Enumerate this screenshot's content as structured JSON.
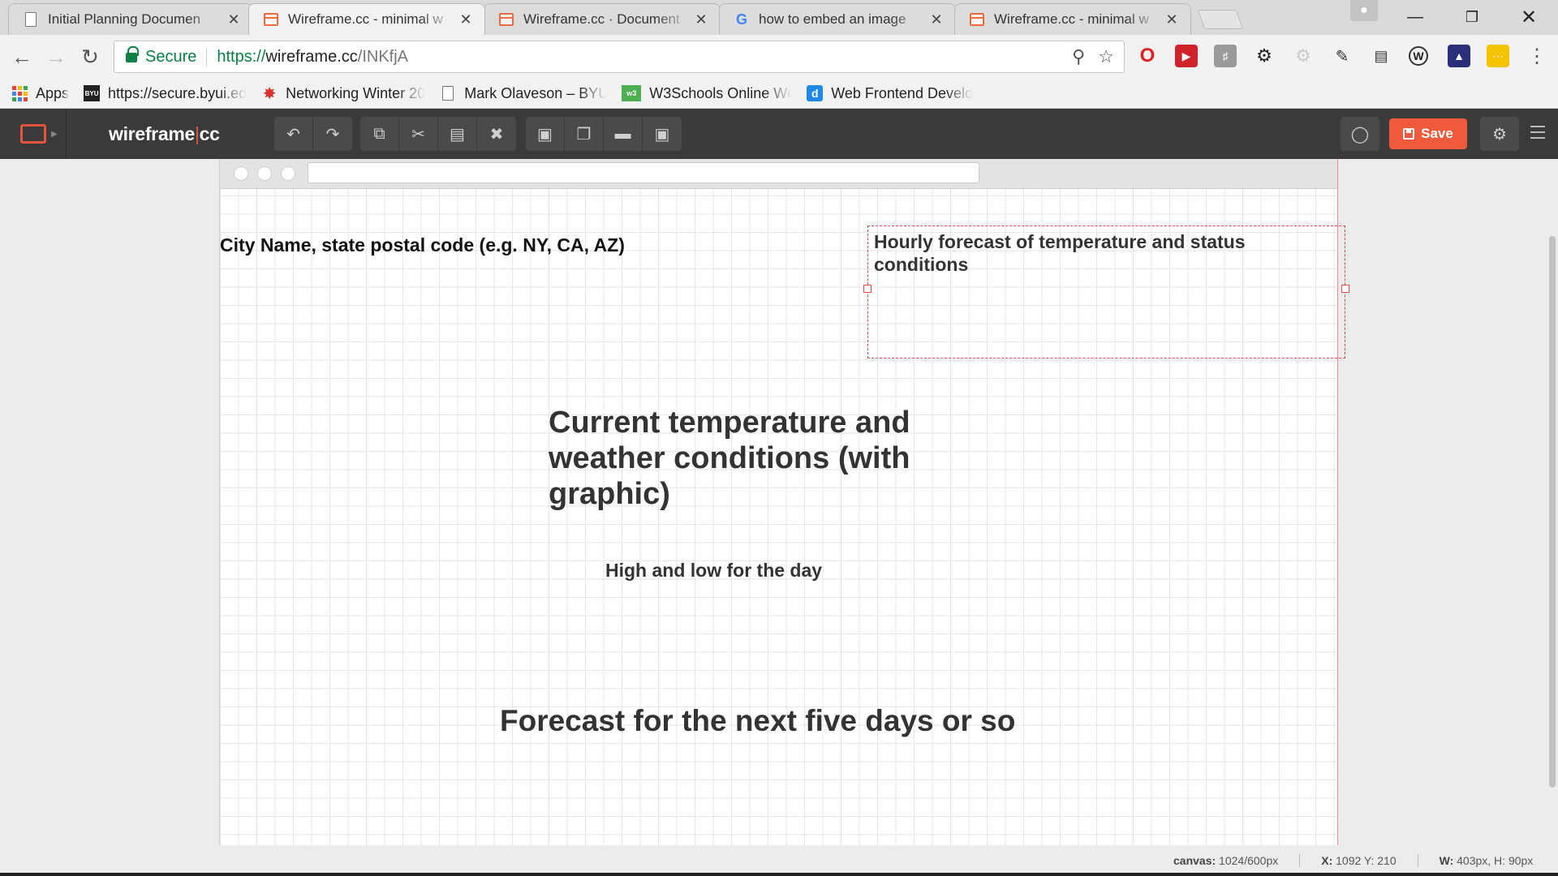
{
  "browser": {
    "tabs": [
      {
        "title": "Initial Planning Documen",
        "icon": "document-icon"
      },
      {
        "title": "Wireframe.cc - minimal w",
        "icon": "wireframe-icon"
      },
      {
        "title": "Wireframe.cc · Document",
        "icon": "wireframe-icon"
      },
      {
        "title": "how to embed an image",
        "icon": "google-icon"
      },
      {
        "title": "Wireframe.cc - minimal w",
        "icon": "wireframe-icon"
      }
    ],
    "active_tab": 1,
    "tab_close_glyph": "✕",
    "address": {
      "secure_label": "Secure",
      "scheme": "https://",
      "host": "wireframe.cc",
      "path": "/INKfjA"
    },
    "bookmarks": [
      {
        "label": "Apps",
        "icon": "apps-icon"
      },
      {
        "label": "https://secure.byui.ed",
        "icon": "byui-icon"
      },
      {
        "label": "Networking Winter 20",
        "icon": "network-icon"
      },
      {
        "label": "Mark Olaveson – BYU-",
        "icon": "document-icon"
      },
      {
        "label": "W3Schools Online We",
        "icon": "w3schools-icon"
      },
      {
        "label": "Web Frontend Develo",
        "icon": "d-icon"
      }
    ]
  },
  "app": {
    "logo_main": "wireframe",
    "logo_sep": "|",
    "logo_suffix": "cc",
    "save_label": "Save",
    "accent_color": "#f05a3c"
  },
  "canvas": {
    "city_label": "City Name, state postal code (e.g. NY, CA, AZ)",
    "hourly_label": "Hourly forecast of temperature and status conditions",
    "current_label": "Current temperature and weather conditions (with graphic)",
    "highlow_label": "High and low for the day",
    "forecast_label": "Forecast for the next five days or so"
  },
  "status": {
    "canvas_label": "canvas:",
    "canvas_value": "1024/600px",
    "coords_label": "X:",
    "coords_value": "1092 Y: 210",
    "size_label": "W:",
    "size_value": "403px, H: 90px"
  }
}
